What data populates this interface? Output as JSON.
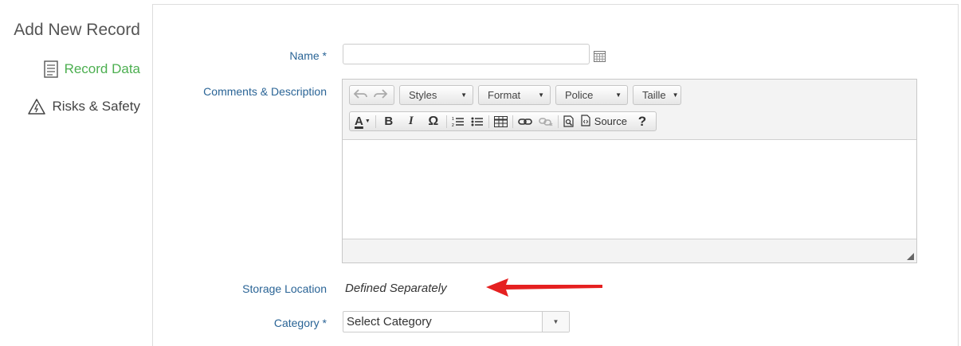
{
  "sidebar": {
    "title": "Add New Record",
    "items": [
      {
        "label": "Record Data",
        "icon": "document-icon",
        "active": true
      },
      {
        "label": "Risks & Safety",
        "icon": "warning-icon",
        "active": false
      }
    ]
  },
  "form": {
    "name_label": "Name *",
    "name_value": "",
    "comments_label": "Comments & Description",
    "storage_label": "Storage Location",
    "storage_value": "Defined Separately",
    "category_label": "Category *",
    "category_value": "Select Category"
  },
  "editor": {
    "combos": [
      "Styles",
      "Format",
      "Police",
      "Taille"
    ],
    "source_label": "Source",
    "content": ""
  },
  "colors": {
    "accent": "#4caf50",
    "label": "#2a6496",
    "arrow": "#e52020"
  }
}
